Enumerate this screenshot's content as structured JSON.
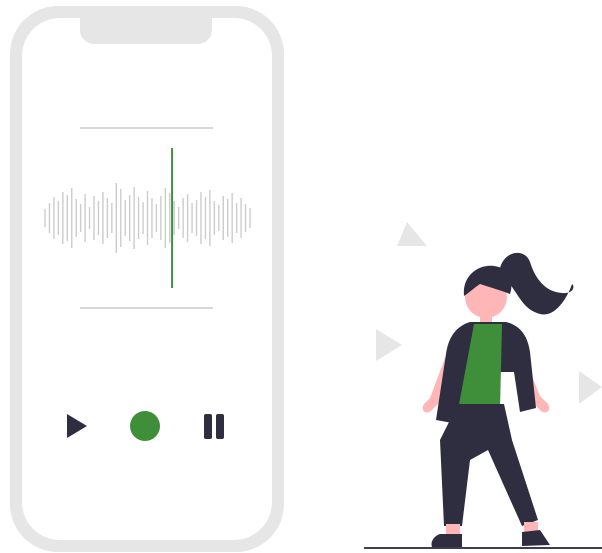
{
  "colors": {
    "phone_frame": "#e6e6e6",
    "screen": "#ffffff",
    "divider": "#cccccc",
    "waveform": "#cccccc",
    "playhead": "#3f8f3a",
    "control_dark": "#2f2e41",
    "record": "#3f8f3a",
    "shirt": "#3f8f3a",
    "skin": "#ffb6b6",
    "hair": "#2f2e41",
    "outfit": "#2f2e41",
    "floating_triangles": "#e6e6e6",
    "ground": "#3f3d56"
  },
  "player": {
    "controls": [
      {
        "name": "play-button",
        "icon": "play-icon"
      },
      {
        "name": "record-button",
        "icon": "record-icon"
      },
      {
        "name": "pause-button",
        "icon": "pause-icon"
      }
    ],
    "playback_position": 0.62
  },
  "decorations": {
    "triangle_icons": [
      "triangle-play-icon",
      "triangle-play-icon",
      "triangle-play-icon"
    ]
  }
}
